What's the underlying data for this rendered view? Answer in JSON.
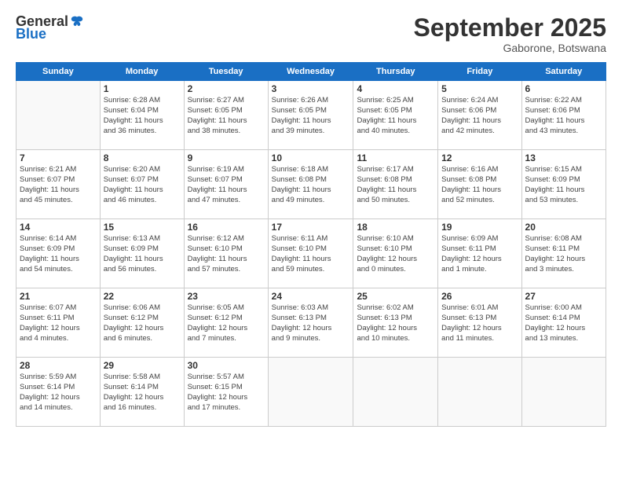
{
  "header": {
    "logo_general": "General",
    "logo_blue": "Blue",
    "month_title": "September 2025",
    "location": "Gaborone, Botswana"
  },
  "weekdays": [
    "Sunday",
    "Monday",
    "Tuesday",
    "Wednesday",
    "Thursday",
    "Friday",
    "Saturday"
  ],
  "weeks": [
    [
      {
        "day": "",
        "info": ""
      },
      {
        "day": "1",
        "info": "Sunrise: 6:28 AM\nSunset: 6:04 PM\nDaylight: 11 hours\nand 36 minutes."
      },
      {
        "day": "2",
        "info": "Sunrise: 6:27 AM\nSunset: 6:05 PM\nDaylight: 11 hours\nand 38 minutes."
      },
      {
        "day": "3",
        "info": "Sunrise: 6:26 AM\nSunset: 6:05 PM\nDaylight: 11 hours\nand 39 minutes."
      },
      {
        "day": "4",
        "info": "Sunrise: 6:25 AM\nSunset: 6:05 PM\nDaylight: 11 hours\nand 40 minutes."
      },
      {
        "day": "5",
        "info": "Sunrise: 6:24 AM\nSunset: 6:06 PM\nDaylight: 11 hours\nand 42 minutes."
      },
      {
        "day": "6",
        "info": "Sunrise: 6:22 AM\nSunset: 6:06 PM\nDaylight: 11 hours\nand 43 minutes."
      }
    ],
    [
      {
        "day": "7",
        "info": "Sunrise: 6:21 AM\nSunset: 6:07 PM\nDaylight: 11 hours\nand 45 minutes."
      },
      {
        "day": "8",
        "info": "Sunrise: 6:20 AM\nSunset: 6:07 PM\nDaylight: 11 hours\nand 46 minutes."
      },
      {
        "day": "9",
        "info": "Sunrise: 6:19 AM\nSunset: 6:07 PM\nDaylight: 11 hours\nand 47 minutes."
      },
      {
        "day": "10",
        "info": "Sunrise: 6:18 AM\nSunset: 6:08 PM\nDaylight: 11 hours\nand 49 minutes."
      },
      {
        "day": "11",
        "info": "Sunrise: 6:17 AM\nSunset: 6:08 PM\nDaylight: 11 hours\nand 50 minutes."
      },
      {
        "day": "12",
        "info": "Sunrise: 6:16 AM\nSunset: 6:08 PM\nDaylight: 11 hours\nand 52 minutes."
      },
      {
        "day": "13",
        "info": "Sunrise: 6:15 AM\nSunset: 6:09 PM\nDaylight: 11 hours\nand 53 minutes."
      }
    ],
    [
      {
        "day": "14",
        "info": "Sunrise: 6:14 AM\nSunset: 6:09 PM\nDaylight: 11 hours\nand 54 minutes."
      },
      {
        "day": "15",
        "info": "Sunrise: 6:13 AM\nSunset: 6:09 PM\nDaylight: 11 hours\nand 56 minutes."
      },
      {
        "day": "16",
        "info": "Sunrise: 6:12 AM\nSunset: 6:10 PM\nDaylight: 11 hours\nand 57 minutes."
      },
      {
        "day": "17",
        "info": "Sunrise: 6:11 AM\nSunset: 6:10 PM\nDaylight: 11 hours\nand 59 minutes."
      },
      {
        "day": "18",
        "info": "Sunrise: 6:10 AM\nSunset: 6:10 PM\nDaylight: 12 hours\nand 0 minutes."
      },
      {
        "day": "19",
        "info": "Sunrise: 6:09 AM\nSunset: 6:11 PM\nDaylight: 12 hours\nand 1 minute."
      },
      {
        "day": "20",
        "info": "Sunrise: 6:08 AM\nSunset: 6:11 PM\nDaylight: 12 hours\nand 3 minutes."
      }
    ],
    [
      {
        "day": "21",
        "info": "Sunrise: 6:07 AM\nSunset: 6:11 PM\nDaylight: 12 hours\nand 4 minutes."
      },
      {
        "day": "22",
        "info": "Sunrise: 6:06 AM\nSunset: 6:12 PM\nDaylight: 12 hours\nand 6 minutes."
      },
      {
        "day": "23",
        "info": "Sunrise: 6:05 AM\nSunset: 6:12 PM\nDaylight: 12 hours\nand 7 minutes."
      },
      {
        "day": "24",
        "info": "Sunrise: 6:03 AM\nSunset: 6:13 PM\nDaylight: 12 hours\nand 9 minutes."
      },
      {
        "day": "25",
        "info": "Sunrise: 6:02 AM\nSunset: 6:13 PM\nDaylight: 12 hours\nand 10 minutes."
      },
      {
        "day": "26",
        "info": "Sunrise: 6:01 AM\nSunset: 6:13 PM\nDaylight: 12 hours\nand 11 minutes."
      },
      {
        "day": "27",
        "info": "Sunrise: 6:00 AM\nSunset: 6:14 PM\nDaylight: 12 hours\nand 13 minutes."
      }
    ],
    [
      {
        "day": "28",
        "info": "Sunrise: 5:59 AM\nSunset: 6:14 PM\nDaylight: 12 hours\nand 14 minutes."
      },
      {
        "day": "29",
        "info": "Sunrise: 5:58 AM\nSunset: 6:14 PM\nDaylight: 12 hours\nand 16 minutes."
      },
      {
        "day": "30",
        "info": "Sunrise: 5:57 AM\nSunset: 6:15 PM\nDaylight: 12 hours\nand 17 minutes."
      },
      {
        "day": "",
        "info": ""
      },
      {
        "day": "",
        "info": ""
      },
      {
        "day": "",
        "info": ""
      },
      {
        "day": "",
        "info": ""
      }
    ]
  ]
}
